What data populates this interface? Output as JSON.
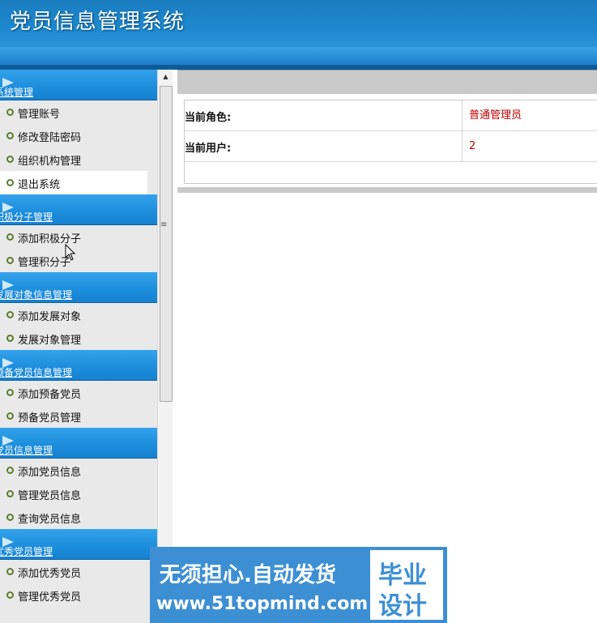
{
  "app": {
    "title": "党员信息管理系统"
  },
  "sidebar": {
    "groups": [
      {
        "title": "系统管理",
        "items": [
          "管理账号",
          "修改登陆密码",
          "组织机构管理",
          "退出系统"
        ]
      },
      {
        "title": "积极分子管理",
        "items": [
          "添加积极分子",
          "管理积分子"
        ]
      },
      {
        "title": "发展对象信息管理",
        "items": [
          "添加发展对象",
          "发展对象管理"
        ]
      },
      {
        "title": "预备党员信息管理",
        "items": [
          "添加预备党员",
          "预备党员管理"
        ]
      },
      {
        "title": "党员信息管理",
        "items": [
          "添加党员信息",
          "管理党员信息",
          "查询党员信息"
        ]
      },
      {
        "title": "优秀党员管理",
        "items": [
          "添加优秀党员",
          "管理优秀党员"
        ]
      }
    ]
  },
  "info": {
    "role_label": "当前角色:",
    "role_value": "普通管理员",
    "user_label": "当前用户:",
    "user_value": "2"
  },
  "watermark": {
    "line1": "无须担心.自动发货",
    "line2": "www.51topmind.com",
    "badge1": "毕业",
    "badge2": "设计"
  }
}
